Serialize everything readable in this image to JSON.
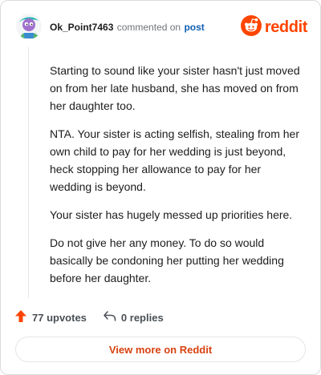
{
  "header": {
    "username": "Ok_Point7463",
    "commented_text": "commented on",
    "post_link": "post",
    "brand": "reddit",
    "avatar_icon": "cartoon-avatar-icon",
    "logo_icon": "reddit-snoo-icon"
  },
  "comment": {
    "paragraphs": [
      "Starting to sound like your sister hasn't just moved on from her late husband, she has moved on from her daughter too.",
      "NTA. Your sister is acting selfish, stealing from her own child to pay for her wedding is just beyond, heck stopping her allowance to pay for her wedding is beyond.",
      "Your sister has hugely messed up priorities here.",
      "Do not give her any money. To do so would basically be condoning her putting her wedding before her daughter."
    ]
  },
  "actions": {
    "upvotes": "77 upvotes",
    "replies": "0 replies",
    "upvote_icon": "upvote-arrow-icon",
    "reply_icon": "reply-arrow-icon"
  },
  "footer": {
    "view_more": "View more on Reddit"
  },
  "colors": {
    "accent": "#ff4500",
    "link": "#0f5fb3",
    "button_text": "#d74210",
    "muted": "#6f7479"
  }
}
